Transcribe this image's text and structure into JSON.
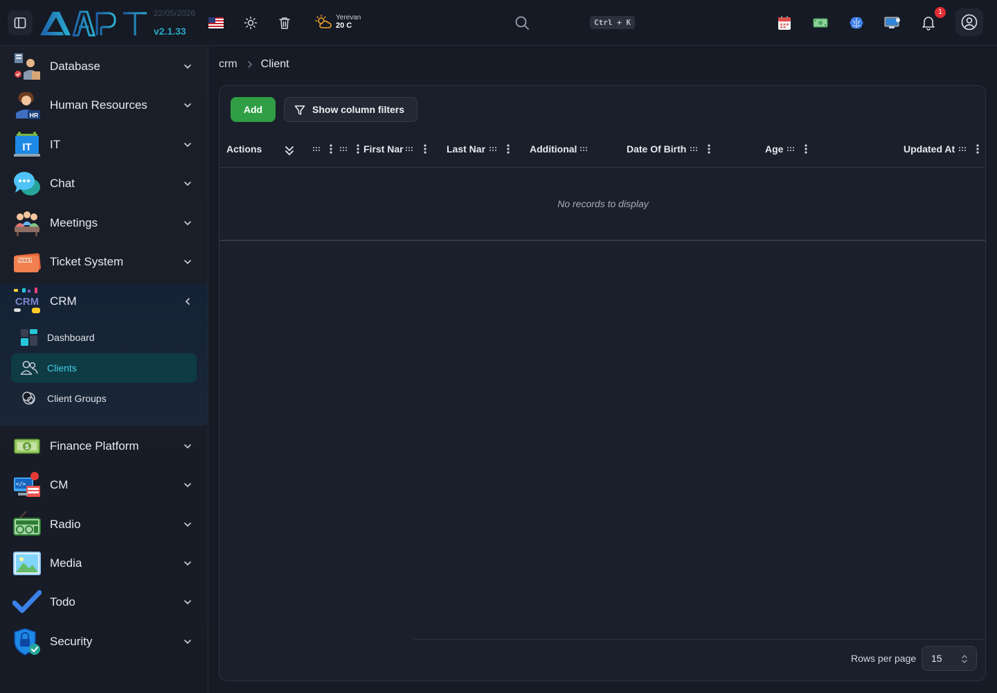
{
  "header": {
    "logo_text": "APIT",
    "date": "22/05/2026",
    "version": "v2.1.33",
    "weather": {
      "city": "Yerevan",
      "temp": "20 C"
    },
    "search_shortcut": "Ctrl + K",
    "notification_count": "1",
    "icons": [
      "sidebar-toggle-icon",
      "us-flag-icon",
      "sun-icon",
      "trash-icon",
      "weather-icon",
      "search-icon",
      "calendar-icon",
      "money-icon",
      "brain-icon",
      "monitor-icon",
      "bell-icon",
      "user-circle-icon"
    ]
  },
  "sidebar": {
    "items": [
      {
        "label": "Database",
        "icon": "database-icon"
      },
      {
        "label": "Human Resources",
        "icon": "hr-icon"
      },
      {
        "label": "IT",
        "icon": "it-icon"
      },
      {
        "label": "Chat",
        "icon": "chat-icon"
      },
      {
        "label": "Meetings",
        "icon": "meetings-icon"
      },
      {
        "label": "Ticket System",
        "icon": "ticket-icon"
      },
      {
        "label": "CRM",
        "icon": "crm-icon",
        "expanded": true
      },
      {
        "label": "Finance Platform",
        "icon": "finance-icon"
      },
      {
        "label": "CM",
        "icon": "cm-icon"
      },
      {
        "label": "Radio",
        "icon": "radio-icon"
      },
      {
        "label": "Media",
        "icon": "media-icon"
      },
      {
        "label": "Todo",
        "icon": "todo-icon"
      },
      {
        "label": "Security",
        "icon": "security-icon"
      }
    ],
    "crm_sub": [
      {
        "label": "Dashboard",
        "icon": "dashboard-icon"
      },
      {
        "label": "Clients",
        "icon": "clients-icon",
        "active": true
      },
      {
        "label": "Client Groups",
        "icon": "client-groups-icon"
      }
    ]
  },
  "breadcrumb": {
    "root": "crm",
    "current": "Client"
  },
  "toolbar": {
    "add_label": "Add",
    "filters_label": "Show column filters"
  },
  "table": {
    "columns": [
      "Actions",
      "First Nar",
      "Last Nar",
      "Additional",
      "Date Of Birth",
      "Age",
      "Updated At"
    ],
    "empty_text": "No records to display"
  },
  "pagination": {
    "rows_per_page_label": "Rows per page",
    "rows_per_page_value": "15"
  },
  "colors": {
    "accent": "#2f9e44",
    "active_text": "#3fd0e6",
    "active_bg": "#0f3b45",
    "badge": "#e02d36"
  }
}
